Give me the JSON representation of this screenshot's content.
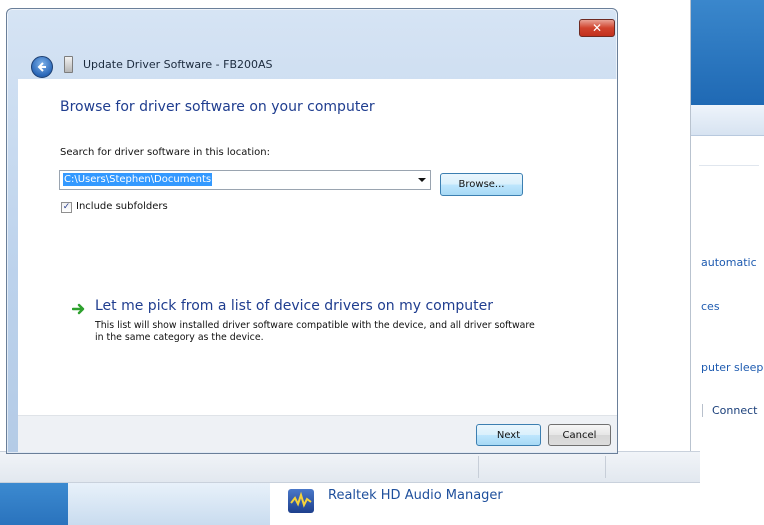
{
  "dialog": {
    "title": "Update Driver Software - FB200AS",
    "close_glyph": "✕",
    "heading": "Browse for driver software on your computer",
    "search_label": "Search for driver software in this location:",
    "path_value": "C:\\Users\\Stephen\\Documents",
    "browse_label": "Browse...",
    "include_subfolders_label": "Include subfolders",
    "include_subfolders_checked": true,
    "pick_title": "Let me pick from a list of device drivers on my computer",
    "pick_description": "This list will show installed driver software compatible with the device, and all driver software in the same category as the device.",
    "next_label": "Next",
    "cancel_label": "Cancel"
  },
  "background": {
    "right_window_links": [
      "automatic",
      "ces",
      "puter sleep",
      "Connect"
    ],
    "taskbar_item_label": "Realtek HD Audio Manager"
  },
  "icons": {
    "back": "back-arrow-icon",
    "device": "usb-device-icon",
    "pick": "green-arrow-icon",
    "realtek": "realtek-audio-icon",
    "checkbox": "checkmark-icon"
  },
  "colors": {
    "heading": "#1f3d8f",
    "selection": "#3399ff",
    "close_button": "#c1301c",
    "pick_arrow": "#2ea12e"
  }
}
